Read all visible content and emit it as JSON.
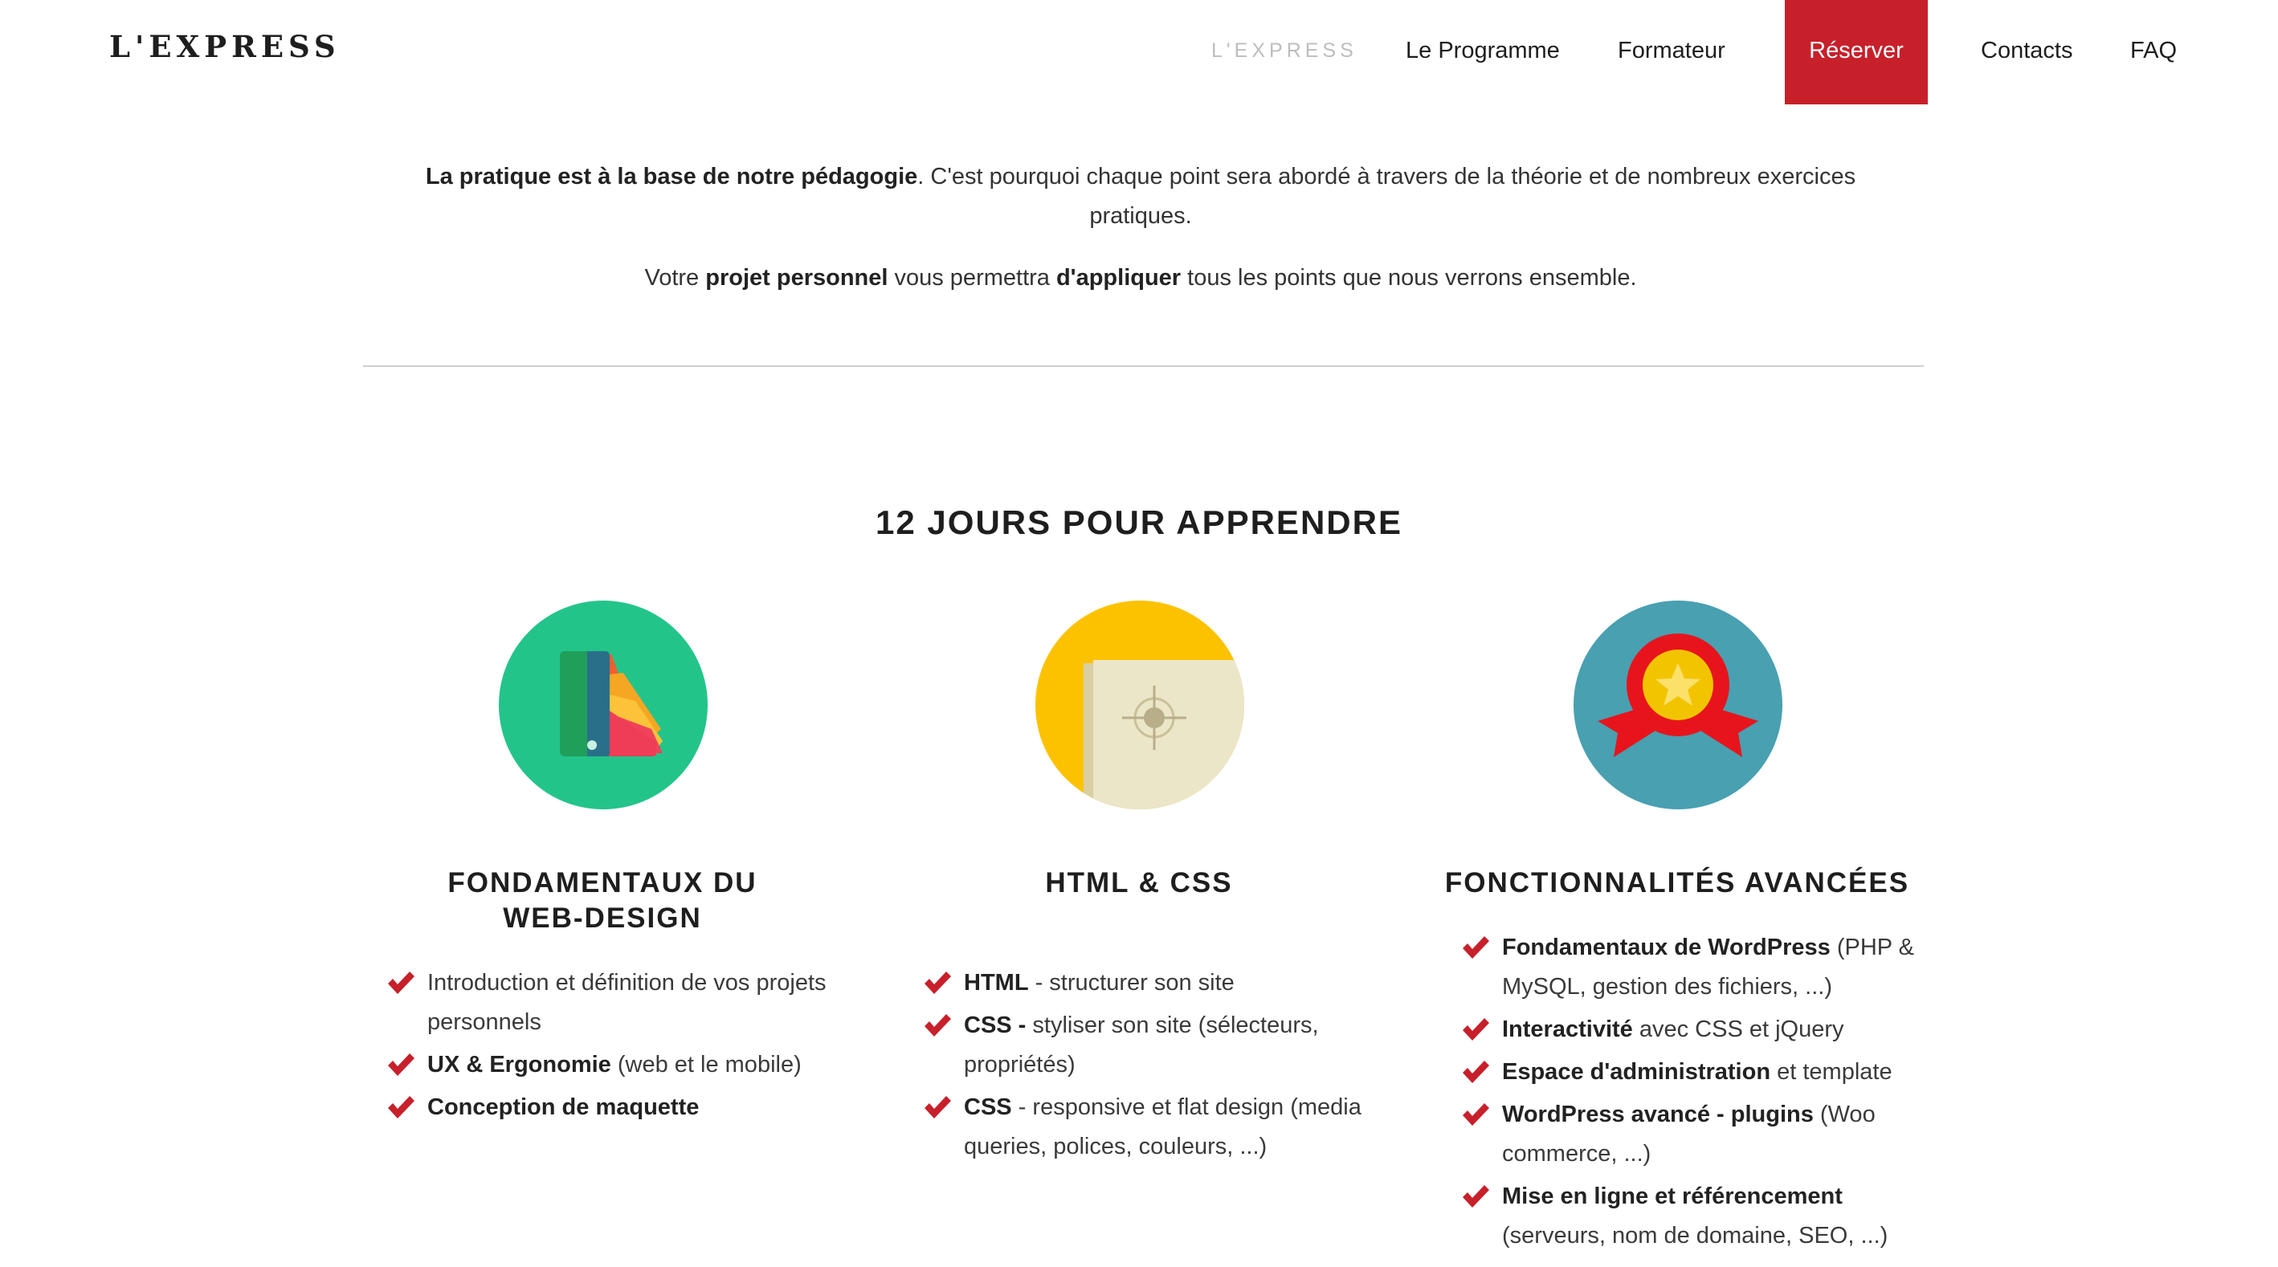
{
  "header": {
    "logo": "L'EXPRESS",
    "nav": [
      {
        "label": "L'EXPRESS",
        "kind": "brand"
      },
      {
        "label": "Le Programme",
        "kind": "link"
      },
      {
        "label": "Formateur",
        "kind": "link"
      },
      {
        "label": "Réserver",
        "kind": "cta"
      },
      {
        "label": "Contacts",
        "kind": "link"
      },
      {
        "label": "FAQ",
        "kind": "link"
      }
    ]
  },
  "intro": {
    "p1_bold": "La pratique est à la base de notre pédagogie",
    "p1_rest": ". C'est pourquoi chaque point sera abordé à travers de la théorie et de nombreux exercices pratiques.",
    "p2_a": "Votre ",
    "p2_b": "projet personnel",
    "p2_c": " vous permettra ",
    "p2_d": "d'appliquer",
    "p2_e": " tous les points que nous verrons ensemble."
  },
  "section": {
    "title": "12 JOURS POUR APPRENDRE",
    "columns": [
      {
        "icon": "color-swatches-icon",
        "title_lines": [
          "FONDAMENTAUX DU",
          "WEB-DESIGN"
        ],
        "items": [
          {
            "bold": "",
            "text": "Introduction et définition de vos projets personnels"
          },
          {
            "bold": "UX & Ergonomie",
            "text": " (web et le mobile)"
          },
          {
            "bold": "Conception de maquette",
            "text": ""
          }
        ]
      },
      {
        "icon": "target-paper-icon",
        "title_lines": [
          "HTML & CSS"
        ],
        "items": [
          {
            "bold": "HTML",
            "text": " - structurer son site"
          },
          {
            "bold": "CSS -",
            "text": " styliser son site (sélecteurs, propriétés)"
          },
          {
            "bold": "CSS",
            "text": " - responsive et flat design (media queries, polices, couleurs, ...)"
          }
        ]
      },
      {
        "icon": "award-ribbon-icon",
        "title_lines": [
          "FONCTIONNALITÉS AVANCÉES"
        ],
        "items": [
          {
            "bold": "Fondamentaux de WordPress",
            "text": " (PHP & MySQL, gestion des fichiers, ...)"
          },
          {
            "bold": "Interactivité",
            "text": " avec CSS et jQuery"
          },
          {
            "bold": "Espace d'administration",
            "text": " et template"
          },
          {
            "bold": "WordPress avancé - plugins",
            "text": " (Woo commerce, ...)"
          },
          {
            "bold": "Mise en ligne et référencement",
            "text": " (serveurs, nom de domaine, SEO, ...)"
          }
        ]
      }
    ]
  },
  "colors": {
    "accent": "#c7202b",
    "icon_green": "#23c48a",
    "icon_yellow": "#fcc200",
    "icon_teal": "#48a0b1"
  }
}
